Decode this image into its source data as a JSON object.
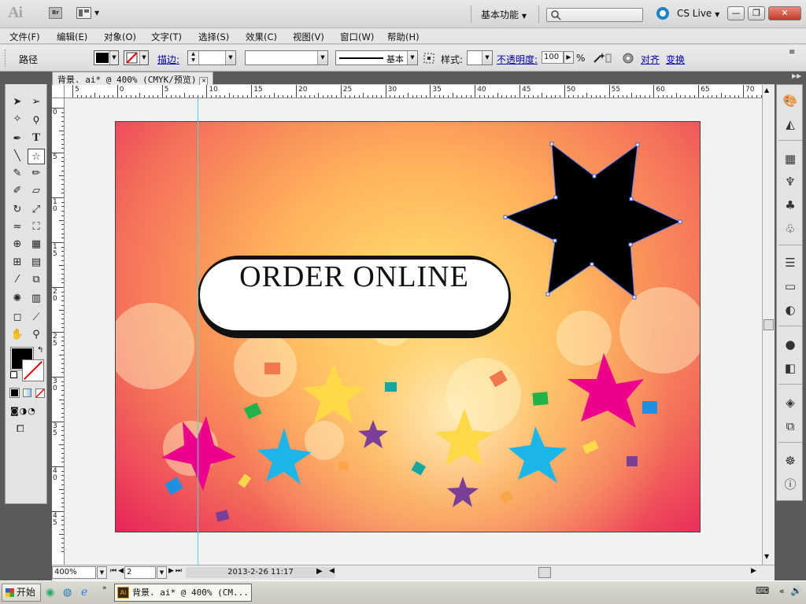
{
  "app": {
    "logo_text": "Ai",
    "bridge_label": "Br",
    "workspace": "基本功能",
    "cslive": "CS Live",
    "win_min": "—",
    "win_restore": "❐",
    "win_close": "✕"
  },
  "menu": [
    "文件(F)",
    "编辑(E)",
    "对象(O)",
    "文字(T)",
    "选择(S)",
    "效果(C)",
    "视图(V)",
    "窗口(W)",
    "帮助(H)"
  ],
  "control_bar": {
    "selection_type": "路径",
    "stroke_label": "描边:",
    "profile_label": "基本",
    "style_label": "样式:",
    "opacity_label": "不透明度:",
    "opacity_value": "100",
    "opacity_unit": "%",
    "align_label": "对齐",
    "transform_label": "变换",
    "fill_color": "#000000"
  },
  "document": {
    "tab_title": "背景. ai* @ 400% (CMYK/预览)",
    "tab_close": "✕"
  },
  "rulers": {
    "h_labels": [
      "5",
      "0",
      "5",
      "10",
      "15",
      "20",
      "25",
      "30",
      "35",
      "40",
      "45",
      "50",
      "55",
      "60",
      "65",
      "70"
    ],
    "v_labels": [
      "0",
      "5",
      "1\n0",
      "1\n5",
      "2\n0",
      "2\n5",
      "3\n0",
      "3\n5",
      "4\n0",
      "4\n5"
    ]
  },
  "artwork": {
    "headline": "ORDER ONLINE"
  },
  "status_bar": {
    "zoom": "400%",
    "page": "2",
    "status_text": "2013-2-26  11:17"
  },
  "taskbar": {
    "start_label": "开始",
    "task_title": "背景. ai* @ 400% (CM...",
    "task_icon": "Ai"
  },
  "colors": {
    "pink": "#ec008c",
    "yellow": "#fdd94a",
    "cyan": "#1cb5ea",
    "purple": "#7b3f98",
    "black": "#000000",
    "guide": "#4fd6e8"
  }
}
